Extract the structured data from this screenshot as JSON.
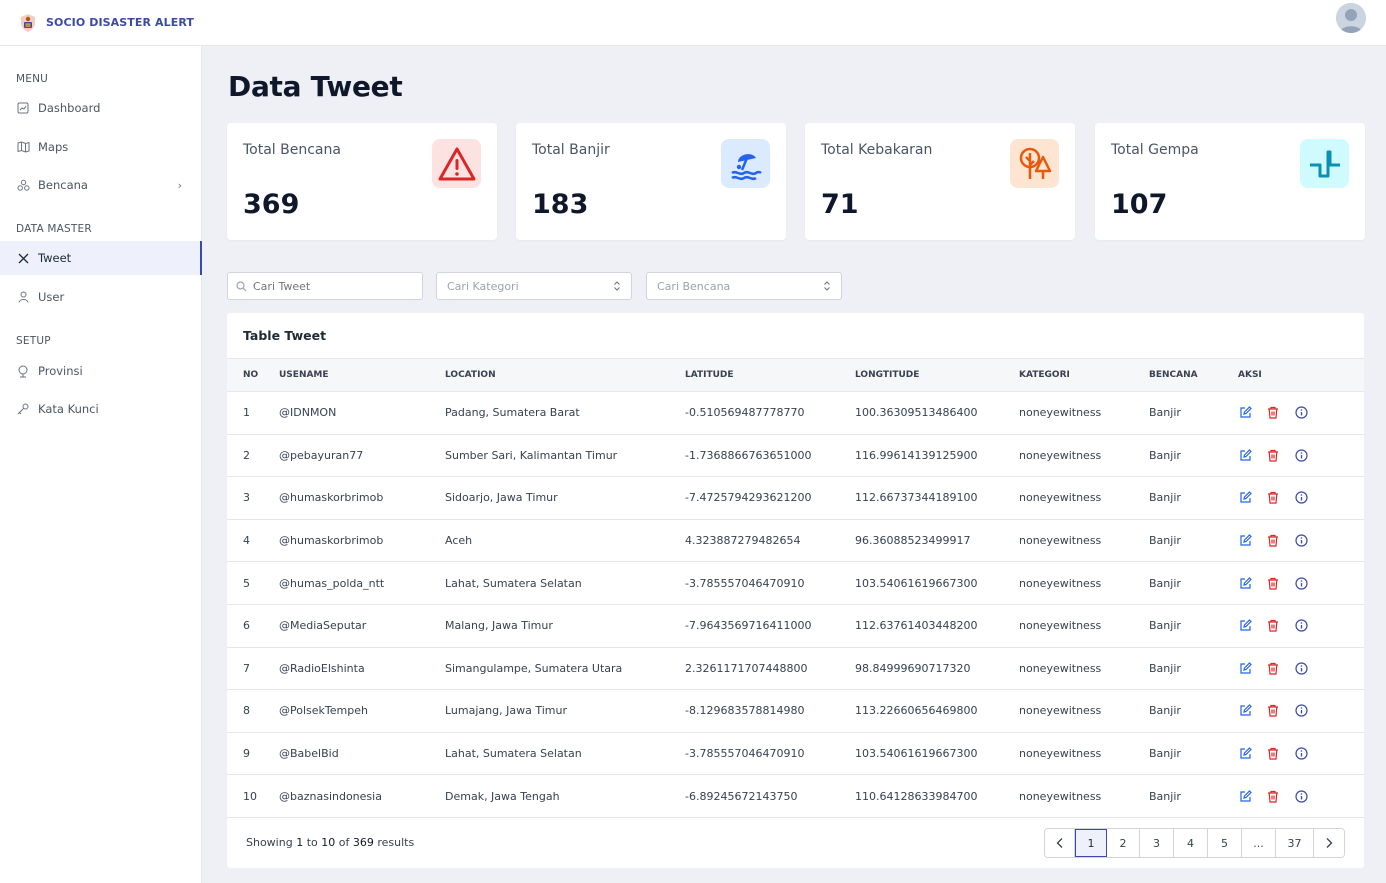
{
  "brand": {
    "name": "SOCIO DISASTER ALERT"
  },
  "sidebar": {
    "sections": [
      {
        "label": "MENU"
      },
      {
        "label": "DATA MASTER"
      },
      {
        "label": "SETUP"
      }
    ],
    "items": [
      {
        "label": "Dashboard",
        "icon": "dashboard-icon"
      },
      {
        "label": "Maps",
        "icon": "map-icon"
      },
      {
        "label": "Bencana",
        "icon": "bencana-icon"
      },
      {
        "label": "Tweet",
        "icon": "x-icon"
      },
      {
        "label": "User",
        "icon": "user-icon"
      },
      {
        "label": "Provinsi",
        "icon": "globe-icon"
      },
      {
        "label": "Kata Kunci",
        "icon": "key-icon"
      }
    ]
  },
  "page": {
    "title": "Data Tweet"
  },
  "cards": [
    {
      "label": "Total Bencana",
      "value": "369",
      "icon": "alert-triangle-icon",
      "color": "#dc2626",
      "bg": "#fde2e2"
    },
    {
      "label": "Total Banjir",
      "value": "183",
      "icon": "flood-umbrella-icon",
      "color": "#2563eb",
      "bg": "#dbeafe"
    },
    {
      "label": "Total Kebakaran",
      "value": "71",
      "icon": "trees-fire-icon",
      "color": "#ea580c",
      "bg": "#fde5d2"
    },
    {
      "label": "Total Gempa",
      "value": "107",
      "icon": "seismic-wave-icon",
      "color": "#0891b2",
      "bg": "#cffafe"
    }
  ],
  "filters": {
    "search_placeholder": "Cari Tweet",
    "kategori_placeholder": "Cari Kategori",
    "bencana_placeholder": "Cari Bencana"
  },
  "table": {
    "title": "Table Tweet",
    "headers": [
      "NO",
      "USENAME",
      "LOCATION",
      "LATITUDE",
      "LONGTITUDE",
      "KATEGORI",
      "BENCANA",
      "AKSI"
    ],
    "rows": [
      [
        "1",
        "@IDNMON",
        "Padang, Sumatera Barat",
        "-0.510569487778770",
        "100.36309513486400",
        "noneyewitness",
        "Banjir"
      ],
      [
        "2",
        "@pebayuran77",
        "Sumber Sari, Kalimantan Timur",
        "-1.7368866763651000",
        "116.99614139125900",
        "noneyewitness",
        "Banjir"
      ],
      [
        "3",
        "@humaskorbrimob",
        "Sidoarjo, Jawa Timur",
        "-7.4725794293621200",
        "112.66737344189100",
        "noneyewitness",
        "Banjir"
      ],
      [
        "4",
        "@humaskorbrimob",
        "Aceh",
        "4.323887279482654",
        "96.36088523499917",
        "noneyewitness",
        "Banjir"
      ],
      [
        "5",
        "@humas_polda_ntt",
        "Lahat, Sumatera Selatan",
        "-3.785557046470910",
        "103.54061619667300",
        "noneyewitness",
        "Banjir"
      ],
      [
        "6",
        "@MediaSeputar",
        "Malang, Jawa Timur",
        "-7.9643569716411000",
        "112.63761403448200",
        "noneyewitness",
        "Banjir"
      ],
      [
        "7",
        "@RadioElshinta",
        "Simangulampe, Sumatera Utara",
        "2.3261171707448800",
        "98.84999690717320",
        "noneyewitness",
        "Banjir"
      ],
      [
        "8",
        "@PolsekTempeh",
        "Lumajang, Jawa Timur",
        "-8.129683578814980",
        "113.22660656469800",
        "noneyewitness",
        "Banjir"
      ],
      [
        "9",
        "@BabelBid",
        "Lahat, Sumatera Selatan",
        "-3.785557046470910",
        "103.54061619667300",
        "noneyewitness",
        "Banjir"
      ],
      [
        "10",
        "@baznasindonesia",
        "Demak, Jawa Tengah",
        "-6.89245672143750",
        "110.64128633984700",
        "noneyewitness",
        "Banjir"
      ]
    ]
  },
  "footer": {
    "showing_prefix": "Showing",
    "from": "1",
    "to_word": "to",
    "to": "10",
    "of_word": "of",
    "total": "369",
    "results_word": "results"
  },
  "pagination": [
    "1",
    "2",
    "3",
    "4",
    "5",
    "...",
    "37"
  ],
  "colors": {
    "accent": "#3b4aa8",
    "edit": "#2563eb",
    "delete": "#dc2626",
    "info": "#3b4aa8"
  }
}
